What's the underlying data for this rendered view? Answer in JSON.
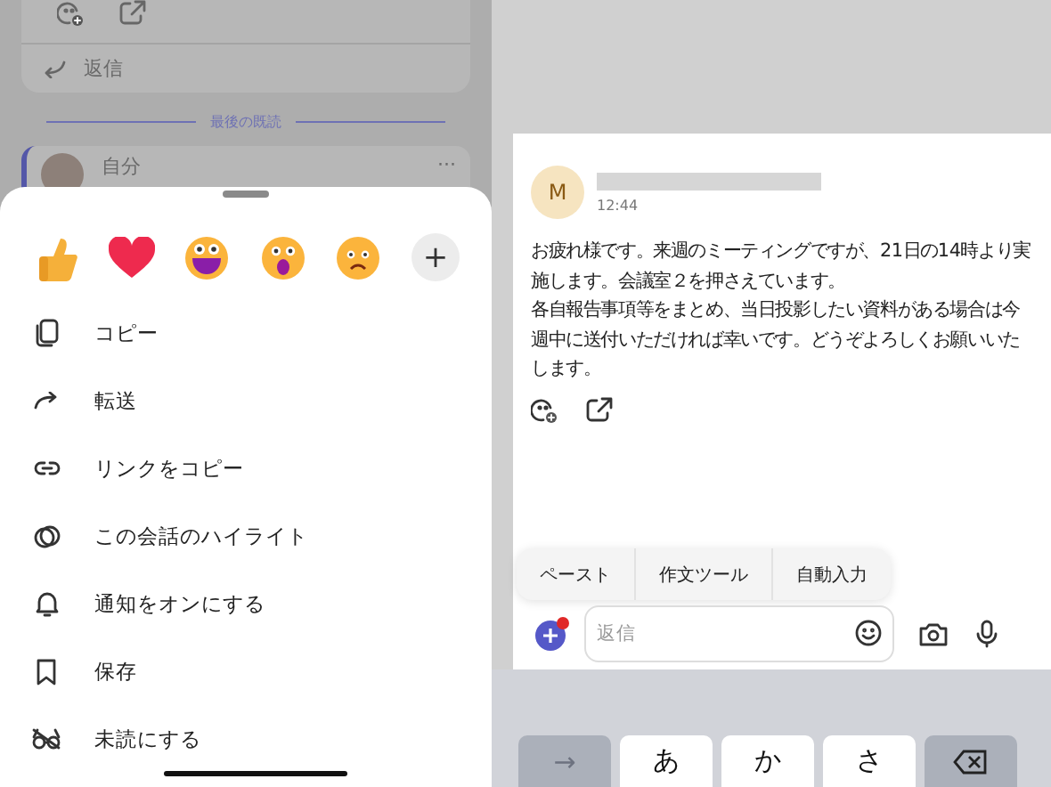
{
  "chat_behind": {
    "reply_label": "返信",
    "last_read_label": "最後の既読",
    "next_sender": "自分",
    "more_label": "···"
  },
  "action_sheet": {
    "reactions": [
      {
        "kind": "thumbs"
      },
      {
        "kind": "heart"
      },
      {
        "kind": "grin"
      },
      {
        "kind": "surprised"
      },
      {
        "kind": "frown"
      }
    ],
    "more_reactions_label": "+",
    "items": [
      {
        "kind": "copy",
        "label": "コピー"
      },
      {
        "kind": "forward",
        "label": "転送"
      },
      {
        "kind": "link",
        "label": "リンクをコピー"
      },
      {
        "kind": "highlight",
        "label": "この会話のハイライト"
      },
      {
        "kind": "bell",
        "label": "通知をオンにする"
      },
      {
        "kind": "bookmark",
        "label": "保存"
      },
      {
        "kind": "glasses",
        "label": "未読にする"
      }
    ]
  },
  "message": {
    "avatar_initial": "M",
    "time": "12:44",
    "paragraphs": [
      "お疲れ様です。来週のミーティングですが、21日の14時より実施します。会議室２を押さえています。",
      "各自報告事項等をまとめ、当日投影したい資料がある場合は今週中に送付いただければ幸いです。どうぞよろしくお願いいたします。"
    ]
  },
  "edit_menu": [
    "ペースト",
    "作文ツール",
    "自動入力"
  ],
  "composer": {
    "placeholder": "返信",
    "has_notification": true
  },
  "keyboard": {
    "keys": [
      {
        "kind": "arrow",
        "label": "→"
      },
      {
        "kind": "char",
        "label": "あ"
      },
      {
        "kind": "char",
        "label": "か"
      },
      {
        "kind": "char",
        "label": "さ"
      },
      {
        "kind": "delete"
      }
    ]
  }
}
